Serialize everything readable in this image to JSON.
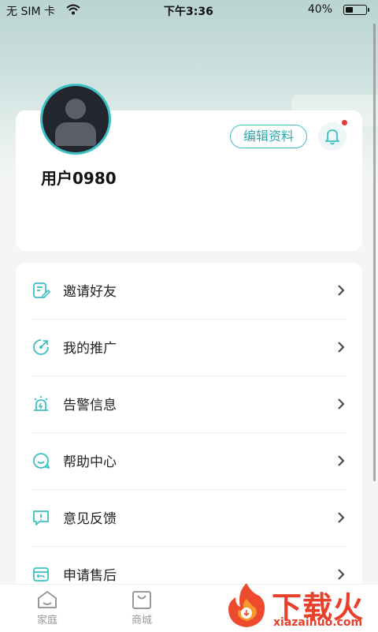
{
  "status_bar": {
    "carrier": "无 SIM 卡",
    "time": "下午3:36",
    "battery_percent": "40%",
    "battery_level": 0.4
  },
  "profile": {
    "username": "用户0980",
    "edit_label": "编辑资料",
    "has_notification": true
  },
  "menu": {
    "items": [
      {
        "label": "邀请好友",
        "icon": "invite-icon"
      },
      {
        "label": "我的推广",
        "icon": "promotion-icon"
      },
      {
        "label": "告警信息",
        "icon": "alarm-icon"
      },
      {
        "label": "帮助中心",
        "icon": "help-icon"
      },
      {
        "label": "意见反馈",
        "icon": "feedback-icon"
      },
      {
        "label": "申请售后",
        "icon": "after-sales-icon"
      }
    ]
  },
  "tabbar": {
    "tabs": [
      {
        "label": "家庭",
        "icon": "home-icon"
      },
      {
        "label": "商城",
        "icon": "shop-icon"
      }
    ]
  },
  "watermark": {
    "title": "下载火",
    "subtitle": "xiazaihuo.com"
  },
  "colors": {
    "accent": "#3cc0c4",
    "badge": "#e23b3b",
    "watermark": "#e8402b"
  }
}
